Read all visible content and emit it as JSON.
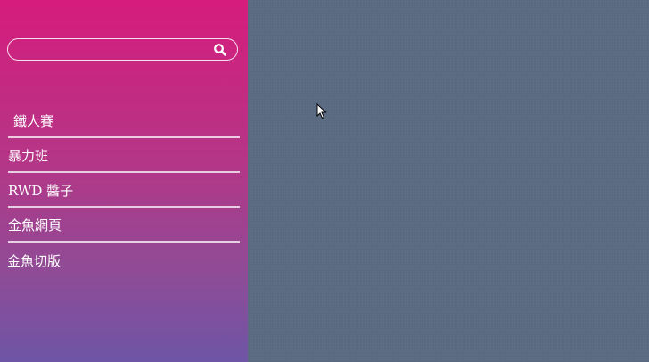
{
  "sidebar": {
    "search": {
      "value": "",
      "placeholder": "",
      "icon": "search-icon"
    },
    "menu": [
      {
        "label": "鐵人賽"
      },
      {
        "label": "暴力班"
      },
      {
        "label": "RWD 醬子"
      },
      {
        "label": "金魚網頁"
      },
      {
        "label": "金魚切版"
      }
    ]
  },
  "colors": {
    "sidebar_top": "#d61c7c",
    "sidebar_bottom": "#6e55a6",
    "content_bg": "#5a6a80",
    "divider": "#ffffff"
  }
}
